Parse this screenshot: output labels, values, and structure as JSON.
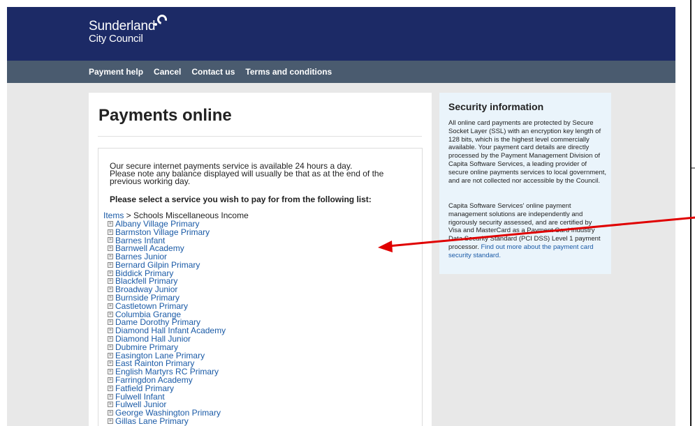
{
  "header": {
    "logo_line1": "Sunderland",
    "logo_line2": "City Council",
    "brand_color": "#1c2a66"
  },
  "nav": {
    "items": [
      "Payment help",
      "Cancel",
      "Contact us",
      "Terms and conditions"
    ],
    "bar_color": "#4a5b6f"
  },
  "main": {
    "title": "Payments online",
    "intro_line1": "Our secure internet payments service is available 24 hours a day.",
    "intro_line2": "Please note any balance displayed will usually be that as at the end of the",
    "intro_line3": "previous working day.",
    "select_heading": "Please select a service you wish to pay for from the following list:",
    "breadcrumb_link": "Items",
    "breadcrumb_rest": " > Schools Miscellaneous Income",
    "services": [
      "Albany Village Primary",
      "Barmston Village Primary",
      "Barnes Infant",
      "Barnwell Academy",
      "Barnes Junior",
      "Bernard Gilpin Primary",
      "Biddick Primary",
      "Blackfell Primary",
      "Broadway Junior",
      "Burnside Primary",
      "Castletown Primary",
      "Columbia Grange",
      "Dame Dorothy Primary",
      "Diamond Hall Infant Academy",
      "Diamond Hall Junior",
      "Dubmire Primary",
      "Easington Lane Primary",
      "East Rainton Primary",
      "English Martyrs RC Primary",
      "Farringdon Academy",
      "Fatfield Primary",
      "Fulwell Infant",
      "Fulwell Junior",
      "George Washington Primary",
      "Gillas Lane Primary"
    ],
    "link_color": "#1a5aa6"
  },
  "security": {
    "title": "Security information",
    "p1": "All online card payments are protected by Secure Socket Layer (SSL) with an encryption key length of 128 bits, which is the highest level commercially available. Your payment card details are directly processed by the Payment Management Division of Capita Software Services, a leading provider of secure online payments services to local government, and are not collected nor accessible by the Council.",
    "p2": "Capita Software Services' online payment management solutions are independently and rigorously security assessed, and are certified by Visa and MasterCard as a Payment Card Industry Data Security Standard (PCI DSS) Level 1 payment processor. ",
    "link": "Find out more about the payment card security standard.",
    "bg_color": "#eaf4fb"
  },
  "annotation": {
    "arrow_color": "#e00000"
  }
}
